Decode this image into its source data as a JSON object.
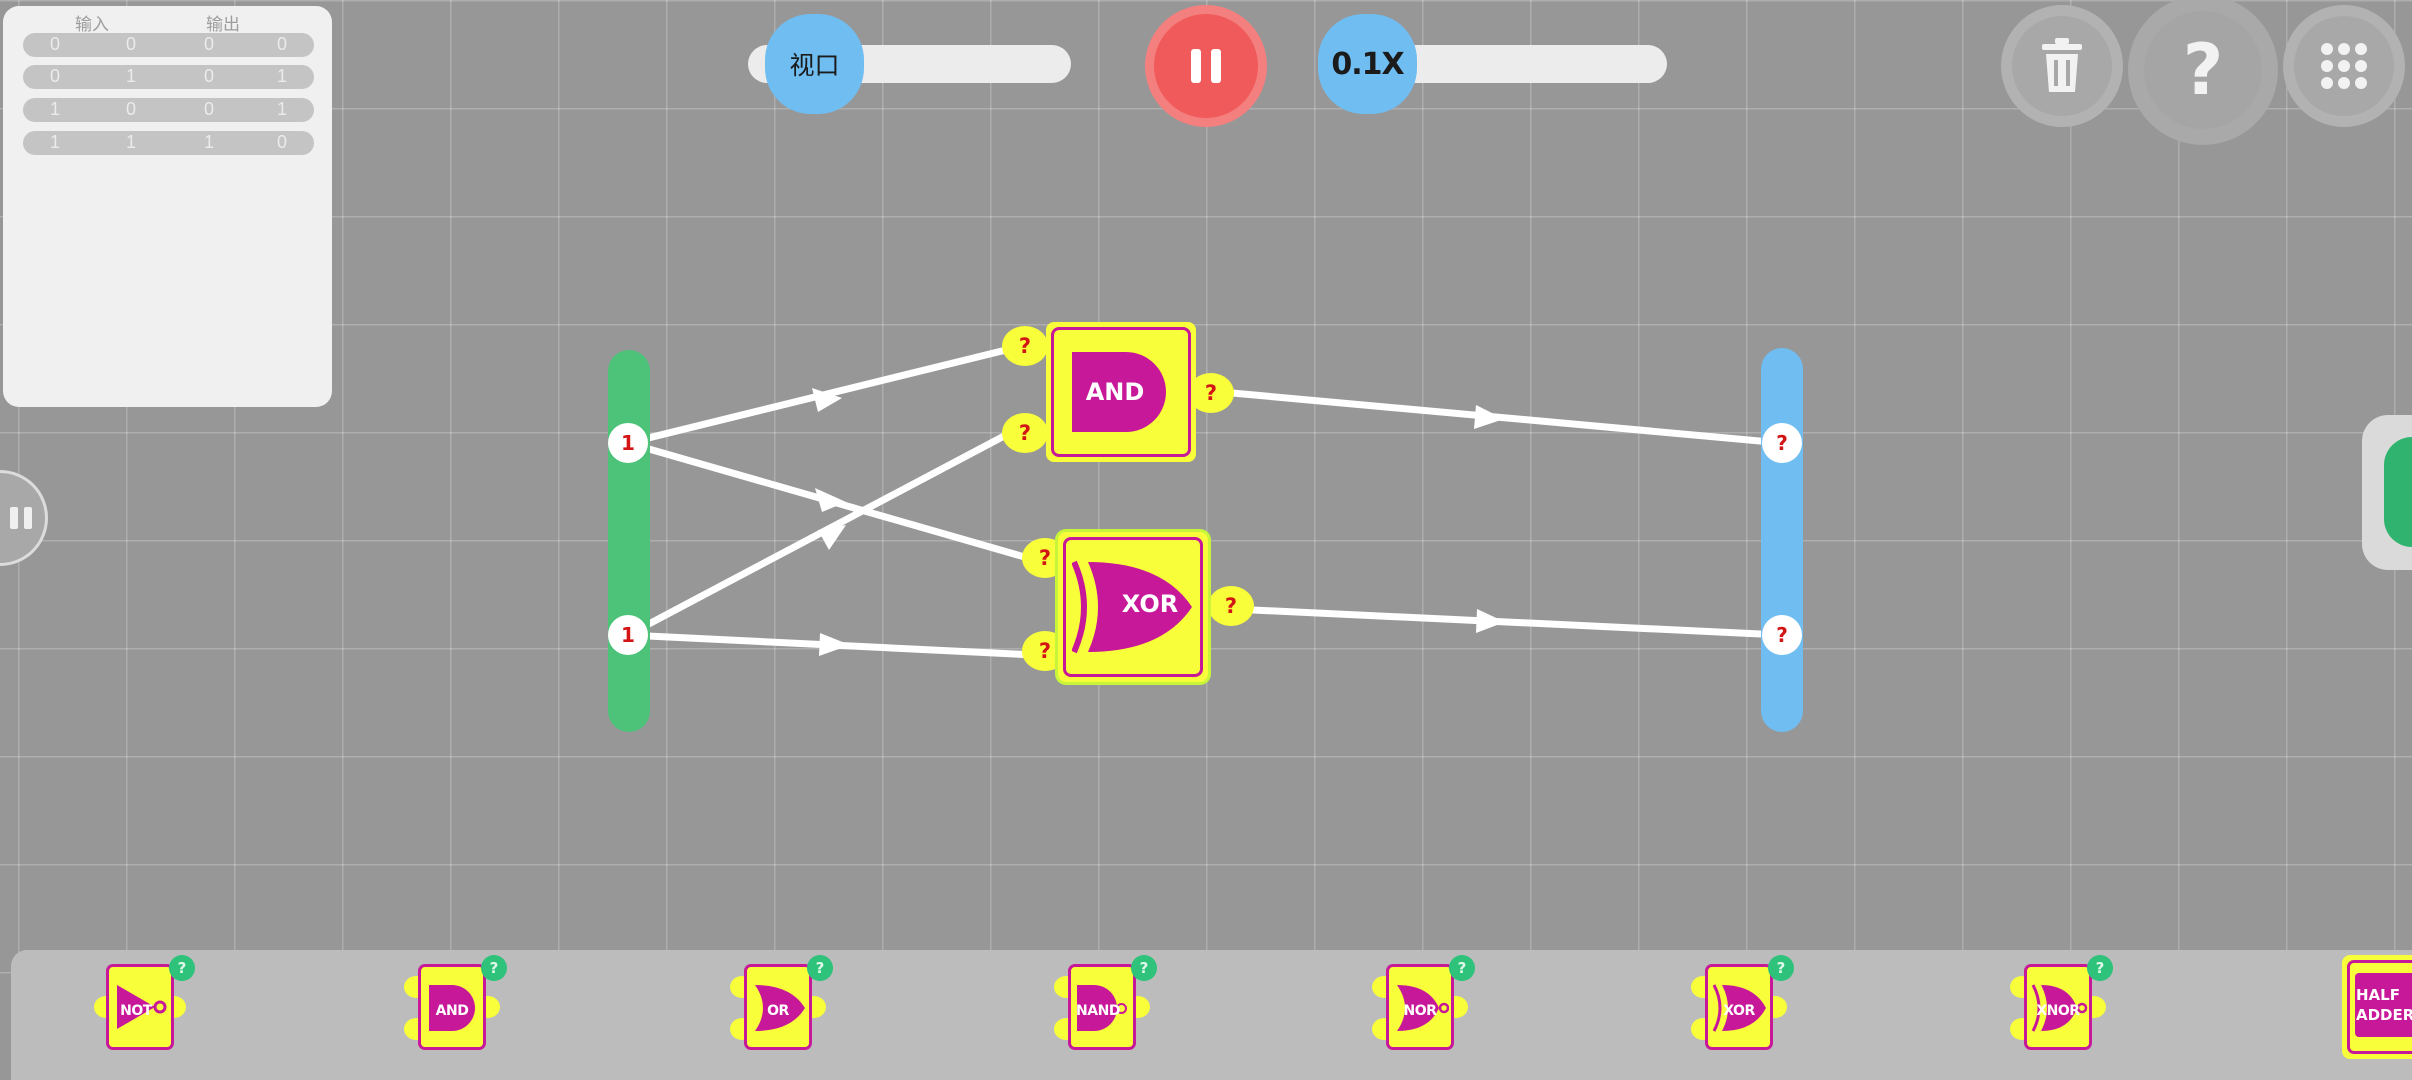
{
  "truth_table": {
    "header_input": "输入",
    "header_output": "输出",
    "rows": [
      [
        "0",
        "0",
        "0",
        "0"
      ],
      [
        "0",
        "1",
        "0",
        "1"
      ],
      [
        "1",
        "0",
        "0",
        "1"
      ],
      [
        "1",
        "1",
        "1",
        "0"
      ]
    ]
  },
  "viewport_slider": {
    "label": "视口"
  },
  "speed_slider": {
    "label": "0.1X"
  },
  "top_buttons": {
    "help": "?"
  },
  "circuit": {
    "inputs": [
      "1",
      "1"
    ],
    "outputs": [
      "?",
      "?"
    ],
    "gates": [
      {
        "label": "AND",
        "pins": [
          "?",
          "?",
          "?"
        ]
      },
      {
        "label": "XOR",
        "pins": [
          "?",
          "?",
          "?"
        ]
      }
    ]
  },
  "toolbox": {
    "items": [
      {
        "label": "NOT",
        "badge": "?"
      },
      {
        "label": "AND",
        "badge": "?"
      },
      {
        "label": "OR",
        "badge": "?"
      },
      {
        "label": "NAND",
        "badge": "?"
      },
      {
        "label": "NOR",
        "badge": "?"
      },
      {
        "label": "XOR",
        "badge": "?"
      },
      {
        "label": "XNOR",
        "badge": "?"
      },
      {
        "label": "HALF ADDER"
      }
    ]
  },
  "colors": {
    "background": "#979797",
    "gate_fill": "#f8ff3a",
    "gate_accent": "#c8189a",
    "input_bar": "#4dc37a",
    "output_bar": "#6fbdf1",
    "pause_button": "#f05a5a",
    "badge": "#2fc27a"
  }
}
